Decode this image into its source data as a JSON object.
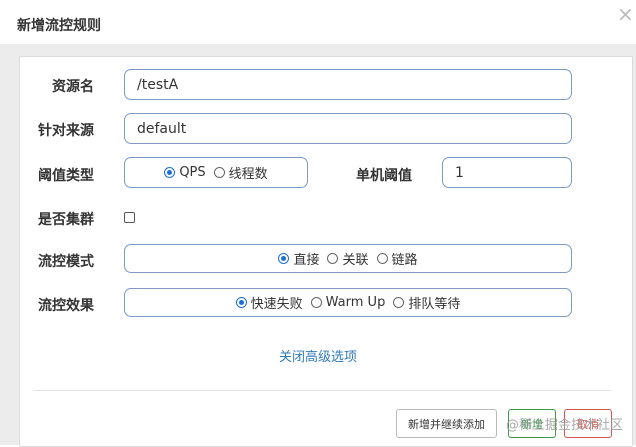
{
  "dialog": {
    "title": "新增流控规则",
    "close_symbol": "×"
  },
  "form": {
    "resource_label": "资源名",
    "resource_value": "/testA",
    "source_label": "针对来源",
    "source_value": "default",
    "threshold_type_label": "阈值类型",
    "threshold_type_options": [
      "QPS",
      "线程数"
    ],
    "threshold_type_selected": "QPS",
    "single_threshold_label": "单机阈值",
    "single_threshold_value": "1",
    "cluster_label": "是否集群",
    "cluster_checked": false,
    "control_mode_label": "流控模式",
    "control_mode_options": [
      "直接",
      "关联",
      "链路"
    ],
    "control_mode_selected": "直接",
    "control_effect_label": "流控效果",
    "control_effect_options": [
      "快速失败",
      "Warm Up",
      "排队等待"
    ],
    "control_effect_selected": "快速失败",
    "advanced_toggle": "关闭高级选项"
  },
  "footer": {
    "add_continue_label": "新增并继续添加",
    "save_label": "新增",
    "cancel_label": "取消"
  },
  "watermark": "@稀土掘金技术社区",
  "colors": {
    "input_border": "#7d99c4",
    "radio_accent": "#1c6fd4",
    "link": "#2f7ab9",
    "save": "#3c9a4a",
    "cancel": "#d9534f"
  }
}
